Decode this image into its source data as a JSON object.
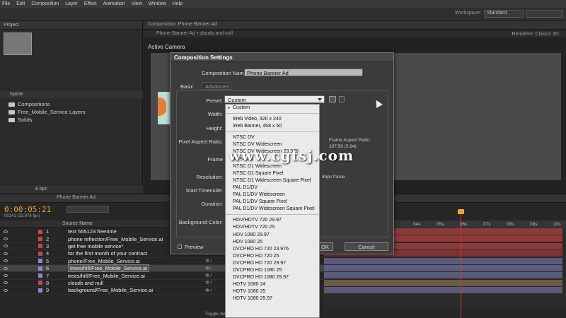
{
  "menubar": [
    "File",
    "Edit",
    "Composition",
    "Layer",
    "Effect",
    "Animation",
    "View",
    "Window",
    "Help"
  ],
  "appbar": {
    "workspace_label": "Workspace:",
    "workspace_value": "Standard"
  },
  "project": {
    "tab": "Project",
    "name_header": "Name",
    "items": [
      "Compositions",
      "Free_Mobile_Service Layers",
      "Solids"
    ],
    "footer_bpc": "8 bpc"
  },
  "comp": {
    "tab": "Composition: Phone Banner Ad",
    "sub_tabs": "Phone Banner Ad  •  clouds and null",
    "active_camera": "Active Camera",
    "renderer": "Renderer:  Classic 3D"
  },
  "timeline": {
    "tab": "Phone Banner Ad",
    "timecode": "0:00:05:21",
    "fps": "00141 (23.976 fps)",
    "source_name_header": "Source Name",
    "ruler": [
      "04s",
      "05s",
      "06s",
      "07s",
      "08s",
      "09s",
      "10s"
    ],
    "toggle": "Toggle Sw",
    "layers": [
      {
        "num": "1",
        "name": "text 555123 free4me",
        "color": "#c9434b",
        "bar": "#8c3a3a"
      },
      {
        "num": "2",
        "name": "phone reflection/Free_Mobile_Service.ai",
        "color": "#c9434b",
        "bar": "#8c3a3a"
      },
      {
        "num": "3",
        "name": "get free mobile service*",
        "color": "#c9434b",
        "bar": "#8c3a3a"
      },
      {
        "num": "4",
        "name": "for the first month of your contract",
        "color": "#c9434b",
        "bar": "#7d3333"
      },
      {
        "num": "5",
        "name": "phone/Free_Mobile_Service.ai",
        "color": "#8a8ad0",
        "bar": "#5a5a7a"
      },
      {
        "num": "6",
        "name": "trees/hill/Free_Mobile_Service.ai",
        "color": "#8a8ad0",
        "bar": "#5e5e82"
      },
      {
        "num": "7",
        "name": "trees/hill/Free_Mobile_Service.ai",
        "color": "#8a8ad0",
        "bar": "#5a5a7a"
      },
      {
        "num": "8",
        "name": "clouds and null",
        "color": "#c9434b",
        "bar": "#6b5a45"
      },
      {
        "num": "9",
        "name": "background/Free_Mobile_Service.ai",
        "color": "#8a8ad0",
        "bar": "#5a5a7a"
      }
    ]
  },
  "dialog": {
    "title": "Composition Settings",
    "comp_name_label": "Composition Name:",
    "comp_name_value": "Phone Banner Ad",
    "tab_basic": "Basic",
    "tab_advanced": "Advanced",
    "preset_label": "Preset:",
    "preset_value": "Custom",
    "width_label": "Width:",
    "height_label": "Height:",
    "pixel_aspect_label": "Pixel Aspect Ratio:",
    "frame_rate_label": "Frame",
    "resolution_label": "Resolution:",
    "start_timecode_label": "Start Timecode:",
    "duration_label": "Duration:",
    "background_color_label": "Background Color:",
    "frame_aspect_label": "Frame Aspect Ratio:",
    "frame_aspect_value": "297:50 (5.94)",
    "bpc_frame": "8bpc frame",
    "preview_label": "Preview",
    "ok_label": "OK",
    "cancel_label": "Cancel"
  },
  "preset_options": [
    "Custom",
    "---",
    "Web Video, 320 x 240",
    "Web Banner, 468 x 60",
    "---",
    "NTSC DV",
    "NTSC DV Widescreen",
    "NTSC DV Widescreen 23.976",
    "NTSC D1",
    "NTSC D1 Widescreen",
    "NTSC D1 Square Pixel",
    "NTSC D1 Widescreen Square Pixel",
    "PAL D1/DV",
    "PAL D1/DV Widescreen",
    "PAL D1/DV Square Pixel",
    "PAL D1/DV Widescreen Square Pixel",
    "---",
    "HDV/HDTV 720 29.97",
    "HDV/HDTV 720 25",
    "HDV 1080 29.97",
    "HDV 1080 25",
    "DVCPRO HD 720 23.976",
    "DVCPRO HD 720 25",
    "DVCPRO HD 720 29.97",
    "DVCPRO HD 1080 25",
    "DVCPRO HD 1080 29.97",
    "HDTV 1080 24",
    "HDTV 1080 25",
    "HDTV 1080 29.97"
  ],
  "watermark": "www.cgtsj.com"
}
